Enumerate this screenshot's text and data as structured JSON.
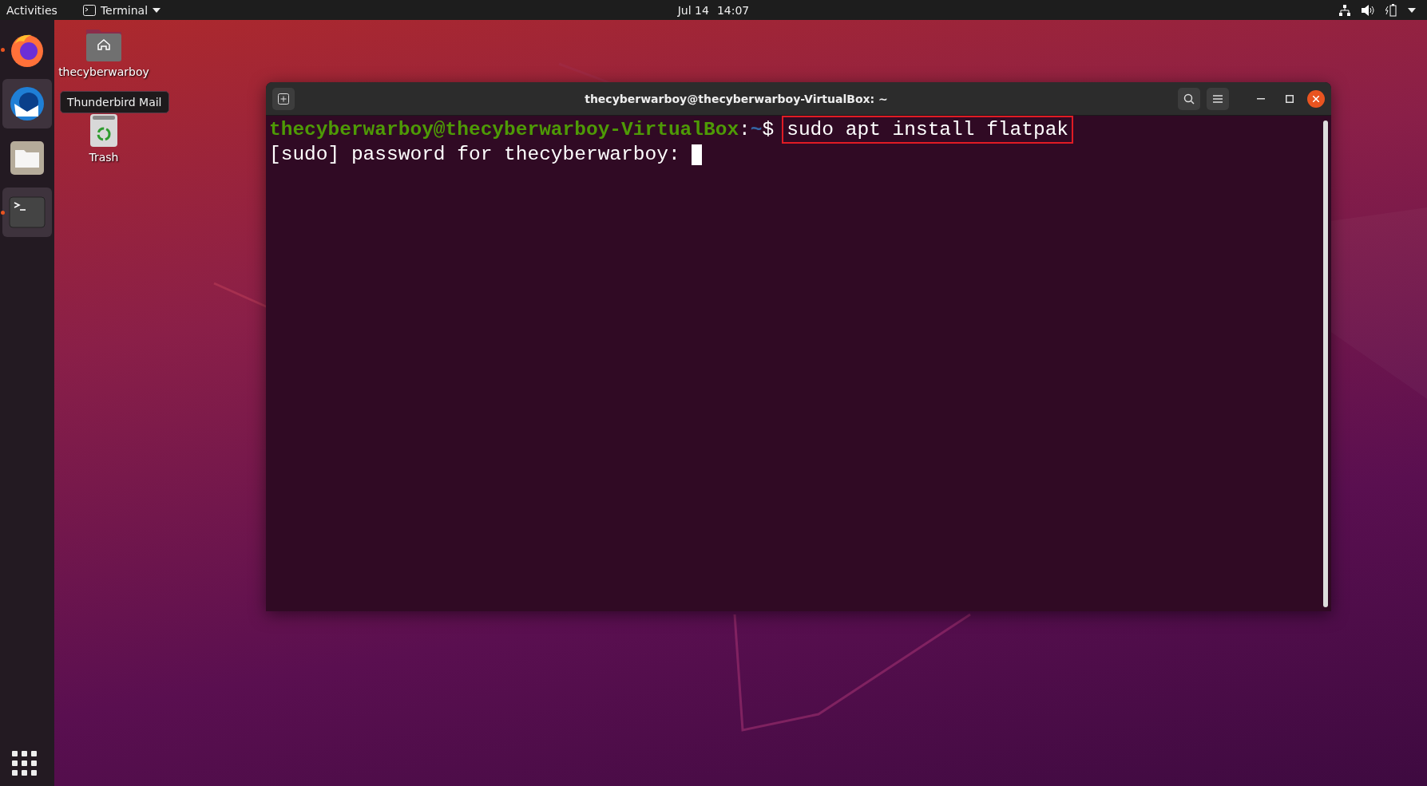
{
  "top_bar": {
    "activities": "Activities",
    "app_menu": "Terminal",
    "date": "Jul 14",
    "time": "14:07"
  },
  "dock": {
    "items": [
      {
        "kind": "firefox",
        "running": true,
        "highlighted": false
      },
      {
        "kind": "thunderbird",
        "running": false,
        "highlighted": true
      },
      {
        "kind": "files",
        "running": false,
        "highlighted": false
      },
      {
        "kind": "terminal",
        "running": true,
        "highlighted": true
      }
    ]
  },
  "desktop_icons": [
    {
      "kind": "home",
      "label": "thecyberwarboy"
    },
    {
      "kind": "trash",
      "label": "Trash"
    }
  ],
  "tooltip": "Thunderbird Mail",
  "terminal": {
    "title": "thecyberwarboy@thecyberwarboy-VirtualBox: ~",
    "prompt": {
      "user_host": "thecyberwarboy@thecyberwarboy-VirtualBox",
      "separator": ":",
      "path": "~",
      "symbol": "$"
    },
    "command": {
      "text": "sudo apt install flatpak",
      "highlighted": true
    },
    "output": "[sudo] password for thecyberwarboy:",
    "cursor": true
  }
}
